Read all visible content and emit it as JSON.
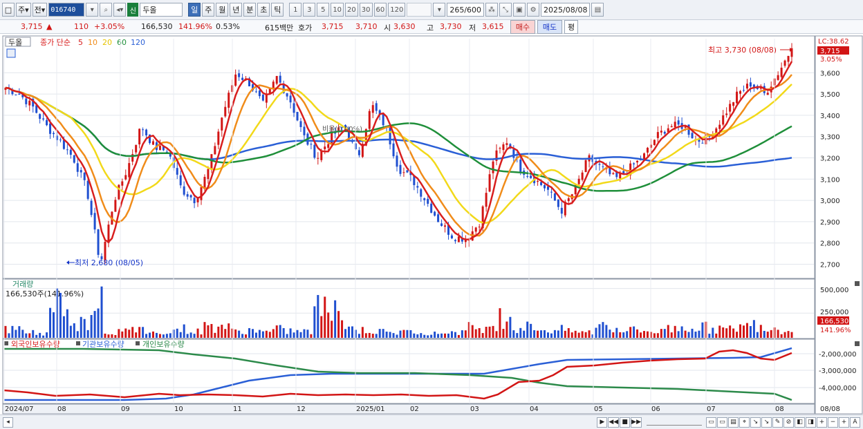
{
  "toolbar": {
    "type1": "주",
    "type2": "전",
    "code": "016740",
    "new_badge": "신",
    "stock_name": "두올",
    "periods": [
      "일",
      "주",
      "월",
      "년",
      "분",
      "초",
      "틱"
    ],
    "active_period": "일",
    "minutes": [
      "1",
      "3",
      "5",
      "10",
      "20",
      "30",
      "60",
      "120"
    ],
    "count": "265",
    "count_total": "/600",
    "date": "2025/08/08"
  },
  "quote": {
    "price": "3,715",
    "change_arrow": "▲",
    "change": "110",
    "change_pct": "+3.05%",
    "volume": "166,530",
    "volume_ratio": "141.96%",
    "turnover": "0.53%",
    "amount": "615백만",
    "bid_label": "호가",
    "ask": "3,715",
    "bid": "3,710",
    "open_label": "시",
    "open": "3,630",
    "high_label": "고",
    "high": "3,730",
    "low_label": "저",
    "low": "3,615",
    "buy": "매수",
    "sell": "매도",
    "eval": "평"
  },
  "legend": {
    "name": "두올",
    "ma_prefix": "종가 단순",
    "mas": [
      {
        "label": "5",
        "color": "#d81e1e"
      },
      {
        "label": "10",
        "color": "#f08c1a"
      },
      {
        "label": "20",
        "color": "#f2d91a"
      },
      {
        "label": "60",
        "color": "#1f8f3a"
      },
      {
        "label": "120",
        "color": "#2a5fd6"
      }
    ]
  },
  "annotations": {
    "max": "최고 3,730 (08/08)",
    "min": "최저 2,680 (08/05)",
    "mid": "비율(0.00%)",
    "lc": "LC:38.62",
    "price_tag": "3,715",
    "pct_tag": "3.05%"
  },
  "volume_panel": {
    "title": "거래량",
    "info": "166,530주(141.96%)",
    "axis": [
      "500,000",
      "250,000"
    ],
    "tag": "166,530",
    "tag_pct": "141.96%"
  },
  "holding_panel": {
    "series": [
      {
        "label": "외국인보유수량",
        "color": "#d81e1e"
      },
      {
        "label": "기관보유수량",
        "color": "#2a5fd6"
      },
      {
        "label": "개인보유수량",
        "color": "#2c8a4a"
      }
    ],
    "axis": [
      "-2,000,000",
      "-3,000,000",
      "-4,000,000"
    ]
  },
  "x_axis": [
    "2024/07",
    "08",
    "09",
    "10",
    "11",
    "12",
    "2025/01",
    "02",
    "03",
    "04",
    "05",
    "06",
    "07",
    "08"
  ],
  "x_axis_end": "08/08",
  "chart_data": {
    "type": "candlestick",
    "y_ticks": [
      3600,
      3500,
      3400,
      3300,
      3200,
      3100,
      3000,
      2900,
      2800,
      2700
    ],
    "ylim": [
      2640,
      3760
    ],
    "last_close": 3715,
    "high": 3730,
    "low": 2680,
    "close_path": [
      3530,
      3500,
      3440,
      3350,
      3280,
      3200,
      3050,
      2700,
      3000,
      3150,
      3350,
      3250,
      3230,
      3050,
      3000,
      3150,
      3400,
      3600,
      3550,
      3450,
      3580,
      3470,
      3300,
      3200,
      3300,
      3350,
      3200,
      3450,
      3350,
      3150,
      3100,
      3000,
      2900,
      2830,
      2820,
      2900,
      3200,
      3280,
      3150,
      3100,
      3050,
      2950,
      3050,
      3200,
      3150,
      3100,
      3150,
      3200,
      3300,
      3350,
      3350,
      3280,
      3300,
      3400,
      3500,
      3550,
      3500,
      3600,
      3715
    ],
    "volume_values": [
      120,
      90,
      60,
      500,
      300,
      220,
      520,
      80,
      90,
      110,
      70,
      100,
      130,
      90,
      160,
      180,
      90,
      110,
      80,
      120,
      100,
      90,
      420,
      380,
      140,
      110,
      90,
      70,
      80,
      100,
      60,
      80,
      90,
      150,
      120,
      300,
      140,
      160,
      110,
      120,
      90,
      80,
      160,
      140,
      110,
      100,
      90,
      130,
      160,
      150,
      130,
      120,
      160,
      180,
      150,
      120,
      167
    ],
    "volume_ylim": [
      0,
      560
    ]
  }
}
